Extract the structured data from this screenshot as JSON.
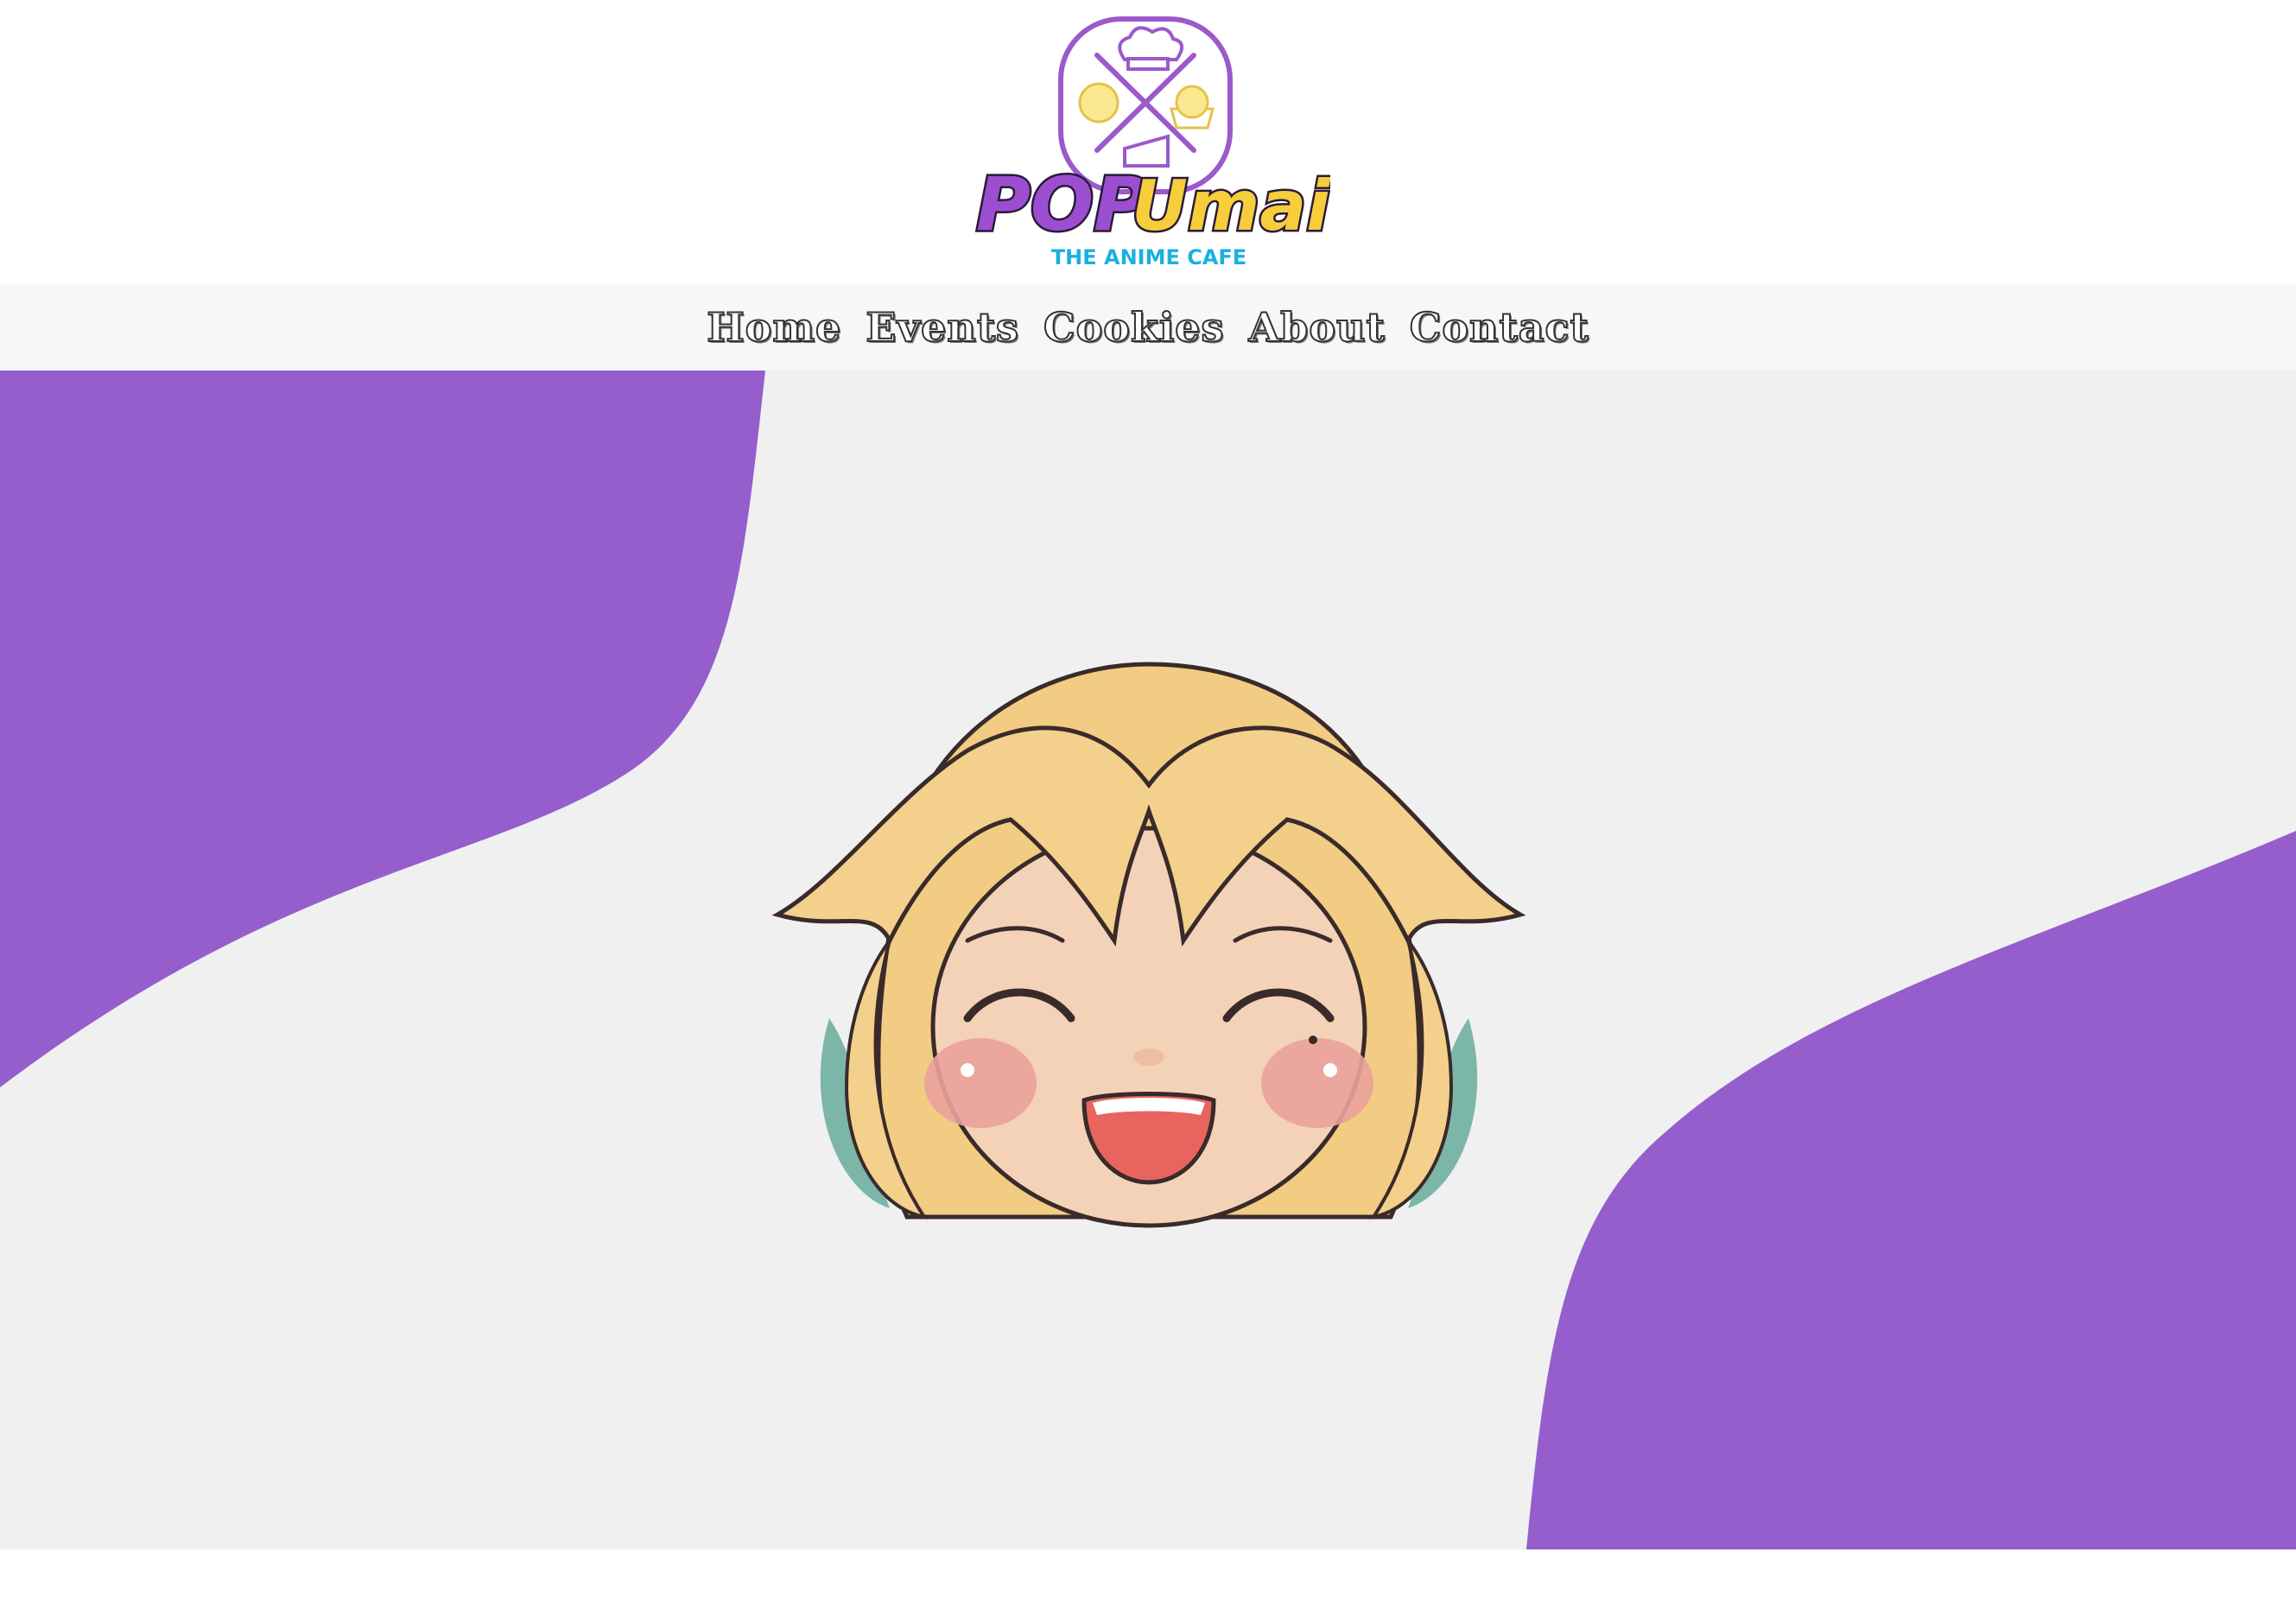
{
  "brand": {
    "name_part1": "POP",
    "name_part2": "Umai",
    "tagline": "THE ANIME CAFE"
  },
  "nav": {
    "items": [
      {
        "label": "Home"
      },
      {
        "label": "Events"
      },
      {
        "label": "Cookies"
      },
      {
        "label": "About"
      },
      {
        "label": "Contact"
      }
    ]
  },
  "colors": {
    "brand_purple": "#955ecc",
    "brand_yellow": "#f6cd3b",
    "brand_blue": "#1ab0e0",
    "hero_background": "#f0f0f0",
    "nav_background": "#f6f7f8"
  },
  "hero": {
    "mascot": "smiling-chibi-character-head"
  }
}
